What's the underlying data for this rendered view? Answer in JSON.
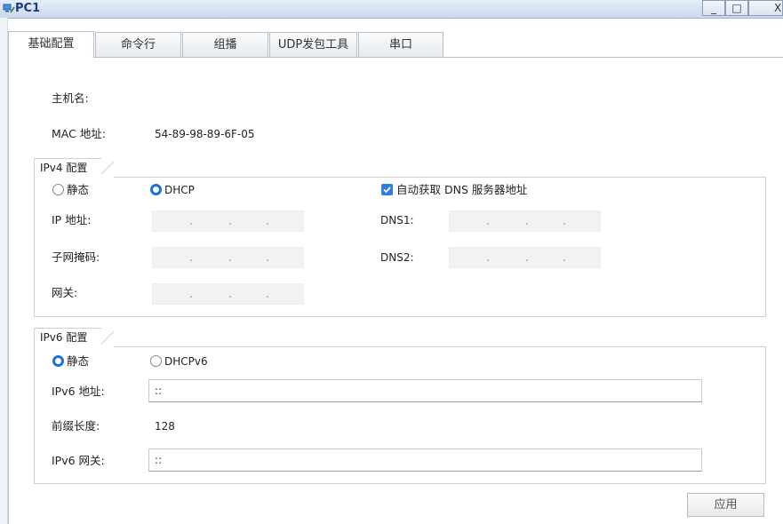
{
  "window": {
    "title": "PC1",
    "minimize": "_",
    "maximize": "□",
    "close": "X"
  },
  "tabs": [
    {
      "label": "基础配置",
      "active": true
    },
    {
      "label": "命令行",
      "active": false
    },
    {
      "label": "组播",
      "active": false
    },
    {
      "label": "UDP发包工具",
      "active": false
    },
    {
      "label": "串口",
      "active": false
    }
  ],
  "basic": {
    "hostname_label": "主机名:",
    "hostname_value": "",
    "mac_label": "MAC 地址:",
    "mac_value": "54-89-98-89-6F-05"
  },
  "ipv4": {
    "group_title": "IPv4 配置",
    "static_label": "静态",
    "dhcp_label": "DHCP",
    "mode": "DHCP",
    "auto_dns_label": "自动获取 DNS 服务器地址",
    "auto_dns_checked": true,
    "ip_label": "IP 地址:",
    "mask_label": "子网掩码:",
    "gateway_label": "网关:",
    "dns1_label": "DNS1:",
    "dns2_label": "DNS2:",
    "dot": "."
  },
  "ipv6": {
    "group_title": "IPv6 配置",
    "static_label": "静态",
    "dhcpv6_label": "DHCPv6",
    "mode": "静态",
    "address_label": "IPv6 地址:",
    "address_value": "::",
    "prefix_label": "前缀长度:",
    "prefix_value": "128",
    "gateway_label": "IPv6 网关:",
    "gateway_value": "::"
  },
  "actions": {
    "apply_label": "应用"
  },
  "colors": {
    "accent": "#1e6fd9",
    "title_text": "#1a3d7c",
    "border": "#b5bfcc"
  }
}
